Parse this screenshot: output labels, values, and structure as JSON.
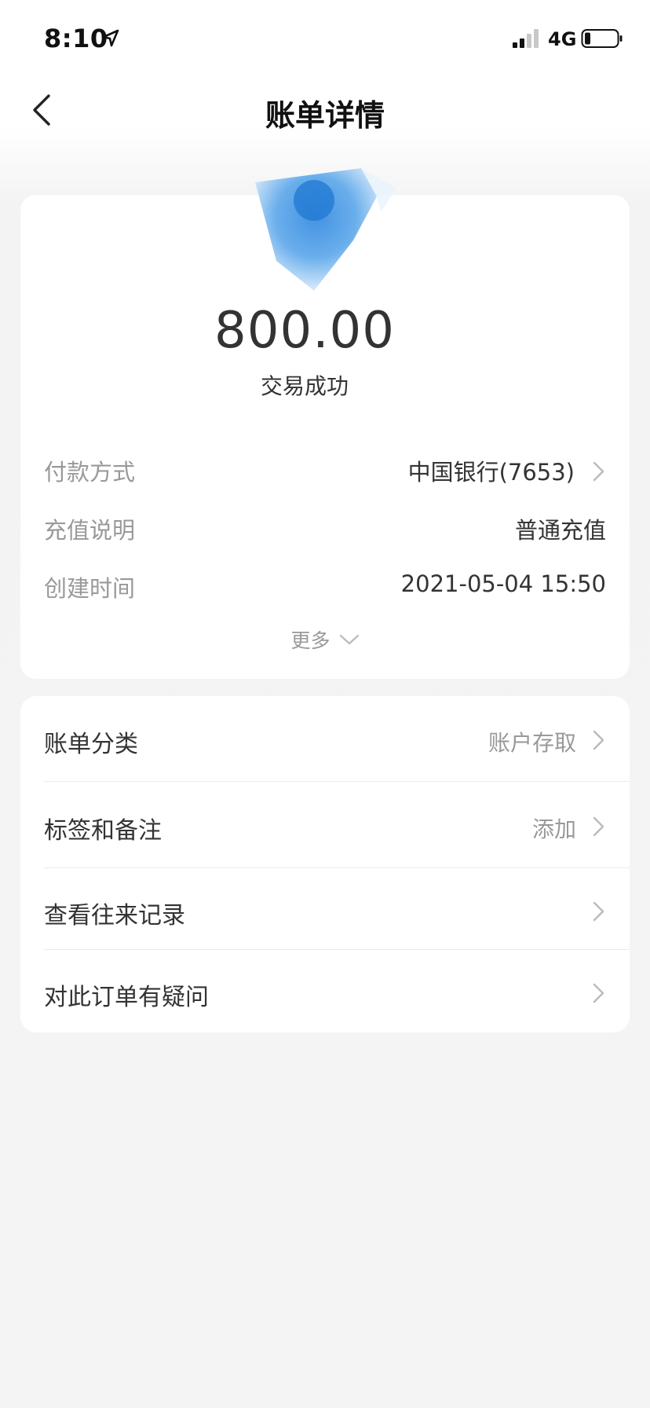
{
  "status_bar": {
    "time": "8:10",
    "network": "4G"
  },
  "nav": {
    "title": "账单详情"
  },
  "summary": {
    "amount": "800.00",
    "status": "交易成功"
  },
  "details": [
    {
      "label": "付款方式",
      "value": "中国银行(7653)"
    },
    {
      "label": "充值说明",
      "value": "普通充值"
    },
    {
      "label": "创建时间",
      "value": "2021-05-04 15:50"
    }
  ],
  "more_label": "更多",
  "menu": [
    {
      "label": "账单分类",
      "value": "账户存取"
    },
    {
      "label": "标签和备注",
      "value": "添加"
    },
    {
      "label": "查看往来记录",
      "value": ""
    },
    {
      "label": "对此订单有疑问",
      "value": ""
    }
  ],
  "colors": {
    "logo_blue": "#3b8fe0",
    "text_primary": "#333333",
    "text_secondary": "#999999",
    "background": "#f4f4f4"
  },
  "icons": [
    "location-arrow-icon",
    "signal-icon",
    "battery-icon",
    "back-chevron-icon",
    "chevron-right-icon",
    "chevron-down-icon"
  ]
}
